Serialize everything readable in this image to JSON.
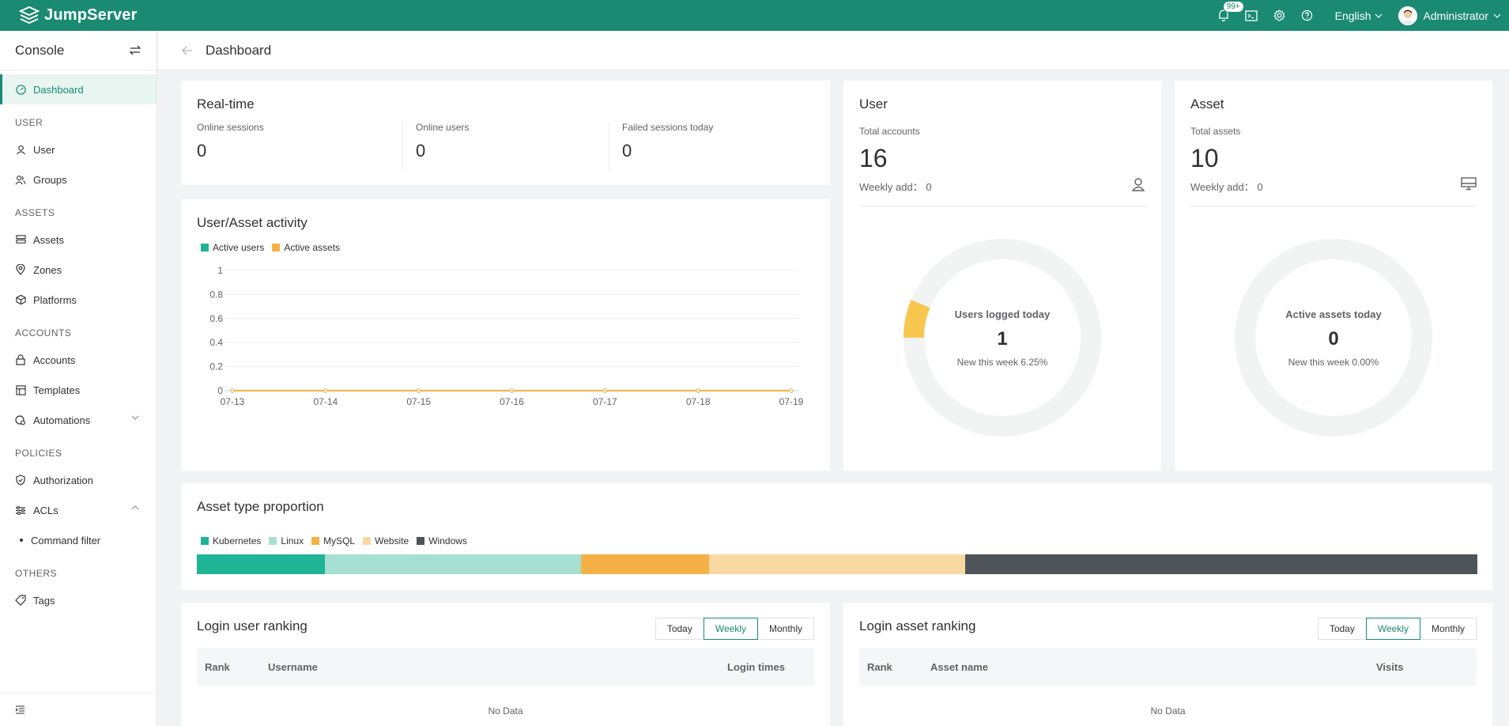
{
  "app": {
    "name": "JumpServer"
  },
  "topbar": {
    "notification_badge": "99+",
    "language": "English",
    "user_name": "Administrator"
  },
  "sidebar": {
    "title": "Console",
    "items": {
      "dashboard": "Dashboard",
      "section_user": "USER",
      "user": "User",
      "groups": "Groups",
      "section_assets": "ASSETS",
      "assets": "Assets",
      "zones": "Zones",
      "platforms": "Platforms",
      "section_accounts": "ACCOUNTS",
      "accounts": "Accounts",
      "templates": "Templates",
      "automations": "Automations",
      "section_policies": "POLICIES",
      "authorization": "Authorization",
      "acls": "ACLs",
      "command_filter": "Command filter",
      "section_others": "OTHERS",
      "tags": "Tags"
    }
  },
  "page": {
    "title": "Dashboard"
  },
  "realtime": {
    "title": "Real-time",
    "online_sessions_label": "Online sessions",
    "online_sessions": "0",
    "online_users_label": "Online users",
    "online_users": "0",
    "failed_sessions_label": "Failed sessions today",
    "failed_sessions": "0"
  },
  "user_card": {
    "title": "User",
    "total_label": "Total accounts",
    "total": "16",
    "weekly_label": "Weekly add：",
    "weekly": "0",
    "donut_title": "Users logged today",
    "donut_value": "1",
    "donut_sub": "New this week 6.25%",
    "donut_fraction": 0.0625
  },
  "asset_card": {
    "title": "Asset",
    "total_label": "Total assets",
    "total": "10",
    "weekly_label": "Weekly add：",
    "weekly": "0",
    "donut_title": "Active assets today",
    "donut_value": "0",
    "donut_sub": "New this week 0.00%",
    "donut_fraction": 0
  },
  "activity": {
    "title": "User/Asset activity"
  },
  "chart_data": {
    "type": "line",
    "x": [
      "07-13",
      "07-14",
      "07-15",
      "07-16",
      "07-17",
      "07-18",
      "07-19"
    ],
    "series": [
      {
        "name": "Active users",
        "values": [
          0,
          0,
          0,
          0,
          0,
          0,
          0
        ],
        "color": "#1fb496"
      },
      {
        "name": "Active assets",
        "values": [
          0,
          0,
          0,
          0,
          0,
          0,
          0
        ],
        "color": "#f3b146"
      }
    ],
    "yticks": [
      "0",
      "0.2",
      "0.4",
      "0.6",
      "0.8",
      "1"
    ],
    "ylim": [
      0,
      1
    ],
    "grid": true,
    "legend": "top-left"
  },
  "asset_types": {
    "title": "Asset type proportion",
    "items": [
      {
        "name": "Kubernetes",
        "fraction": 0.1,
        "color": "#1fb496"
      },
      {
        "name": "Linux",
        "fraction": 0.2,
        "color": "#a5e0d2"
      },
      {
        "name": "MySQL",
        "fraction": 0.1,
        "color": "#f3b146"
      },
      {
        "name": "Website",
        "fraction": 0.2,
        "color": "#f9d9a2"
      },
      {
        "name": "Windows",
        "fraction": 0.4,
        "color": "#4e5458"
      }
    ]
  },
  "login_user_ranking": {
    "title": "Login user ranking",
    "tabs": [
      "Today",
      "Weekly",
      "Monthly"
    ],
    "active_tab": "Weekly",
    "columns": [
      "Rank",
      "Username",
      "Login times"
    ],
    "empty": "No Data"
  },
  "login_asset_ranking": {
    "title": "Login asset ranking",
    "tabs": [
      "Today",
      "Weekly",
      "Monthly"
    ],
    "active_tab": "Weekly",
    "columns": [
      "Rank",
      "Asset name",
      "Visits"
    ],
    "empty": "No Data"
  },
  "colors": {
    "brand": "#1a8a72",
    "donut_track": "#f2f4f3",
    "donut_fill": "#f9c74f"
  }
}
